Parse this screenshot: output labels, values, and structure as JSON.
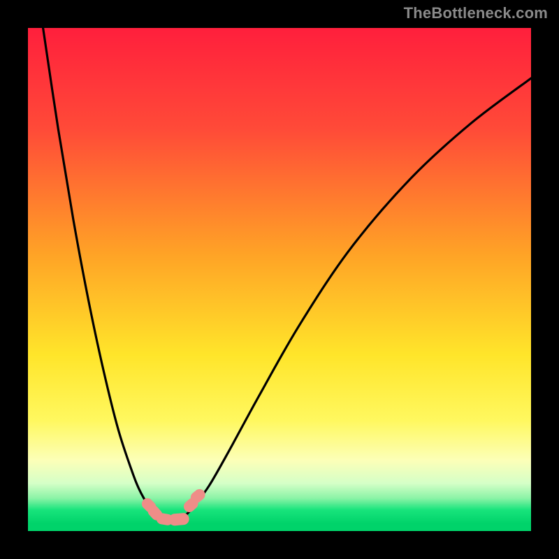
{
  "attribution": "TheBottleneck.com",
  "chart_data": {
    "type": "line",
    "title": "",
    "xlabel": "",
    "ylabel": "",
    "xlim": [
      0,
      100
    ],
    "ylim": [
      0,
      100
    ],
    "grid": false,
    "legend": false,
    "annotations": [],
    "gradient_stops": [
      {
        "offset": 0.0,
        "color": "#ff1f3c"
      },
      {
        "offset": 0.2,
        "color": "#ff4a38"
      },
      {
        "offset": 0.45,
        "color": "#ffa326"
      },
      {
        "offset": 0.65,
        "color": "#ffe52a"
      },
      {
        "offset": 0.78,
        "color": "#fff85f"
      },
      {
        "offset": 0.86,
        "color": "#fcffb8"
      },
      {
        "offset": 0.905,
        "color": "#d5ffc7"
      },
      {
        "offset": 0.935,
        "color": "#8af3a6"
      },
      {
        "offset": 0.958,
        "color": "#18e47c"
      },
      {
        "offset": 0.985,
        "color": "#00d36a"
      },
      {
        "offset": 1.0,
        "color": "#00d36a"
      }
    ],
    "series": [
      {
        "name": "left-branch",
        "x": [
          3,
          6,
          9,
          12,
          15,
          18,
          21,
          22.5,
          24,
          25.5,
          26.5
        ],
        "y": [
          100,
          80,
          62,
          46,
          32,
          20,
          11,
          7.5,
          5,
          3.3,
          2.5
        ]
      },
      {
        "name": "right-branch",
        "x": [
          30,
          31.5,
          33,
          36,
          40,
          46,
          54,
          64,
          76,
          88,
          100
        ],
        "y": [
          2.5,
          3.3,
          5,
          9,
          16,
          27,
          41,
          56,
          70,
          81,
          90
        ]
      },
      {
        "name": "valley-floor",
        "x": [
          26.5,
          27.5,
          28.5,
          29.5,
          30
        ],
        "y": [
          2.5,
          2.35,
          2.3,
          2.35,
          2.5
        ]
      }
    ],
    "markers": [
      {
        "x": 24.0,
        "y": 5.1,
        "w": 3.0,
        "h": 2.2,
        "r": 45
      },
      {
        "x": 25.3,
        "y": 3.6,
        "w": 3.2,
        "h": 2.2,
        "r": 48
      },
      {
        "x": 32.3,
        "y": 5.2,
        "w": 3.0,
        "h": 2.2,
        "r": -42
      },
      {
        "x": 33.7,
        "y": 7.0,
        "w": 3.0,
        "h": 2.2,
        "r": -40
      },
      {
        "x": 27.2,
        "y": 2.4,
        "w": 3.4,
        "h": 2.2,
        "r": 10
      },
      {
        "x": 30.0,
        "y": 2.3,
        "w": 4.0,
        "h": 2.3,
        "r": -5
      }
    ]
  }
}
